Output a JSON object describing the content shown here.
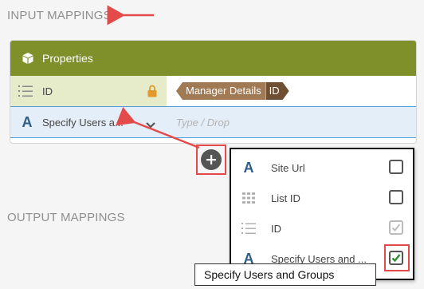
{
  "input_section": {
    "title": "INPUT MAPPINGS"
  },
  "output_section": {
    "title": "OUTPUT MAPPINGS"
  },
  "properties_card": {
    "header_label": "Properties",
    "rows": [
      {
        "label": "ID",
        "icon": "list-lines-icon",
        "locked": true,
        "mapped_chip": {
          "main": "Manager Details",
          "tail": "ID"
        }
      },
      {
        "label": "Specify Users a...",
        "icon": "text-A-icon",
        "placeholder": "Type / Drop"
      }
    ]
  },
  "dropdown": {
    "items": [
      {
        "label": "Site Url",
        "icon": "text-A-icon",
        "checked": false,
        "disabled": false
      },
      {
        "label": "List ID",
        "icon": "grid-icon",
        "checked": false,
        "disabled": false
      },
      {
        "label": "ID",
        "icon": "list-lines-icon",
        "checked": true,
        "disabled": true
      },
      {
        "label": "Specify Users and ...",
        "icon": "text-A-icon",
        "checked": true,
        "disabled": false
      }
    ]
  },
  "tooltip": {
    "text": "Specify Users and Groups"
  },
  "colors": {
    "header_olive": "#7f8f2a",
    "chip_brown": "#a07a55",
    "chip_dark": "#6e4f33",
    "annotation_red": "#e34a4a",
    "selected_blue": "#4a9fd8",
    "check_green": "#2e8b2e"
  }
}
